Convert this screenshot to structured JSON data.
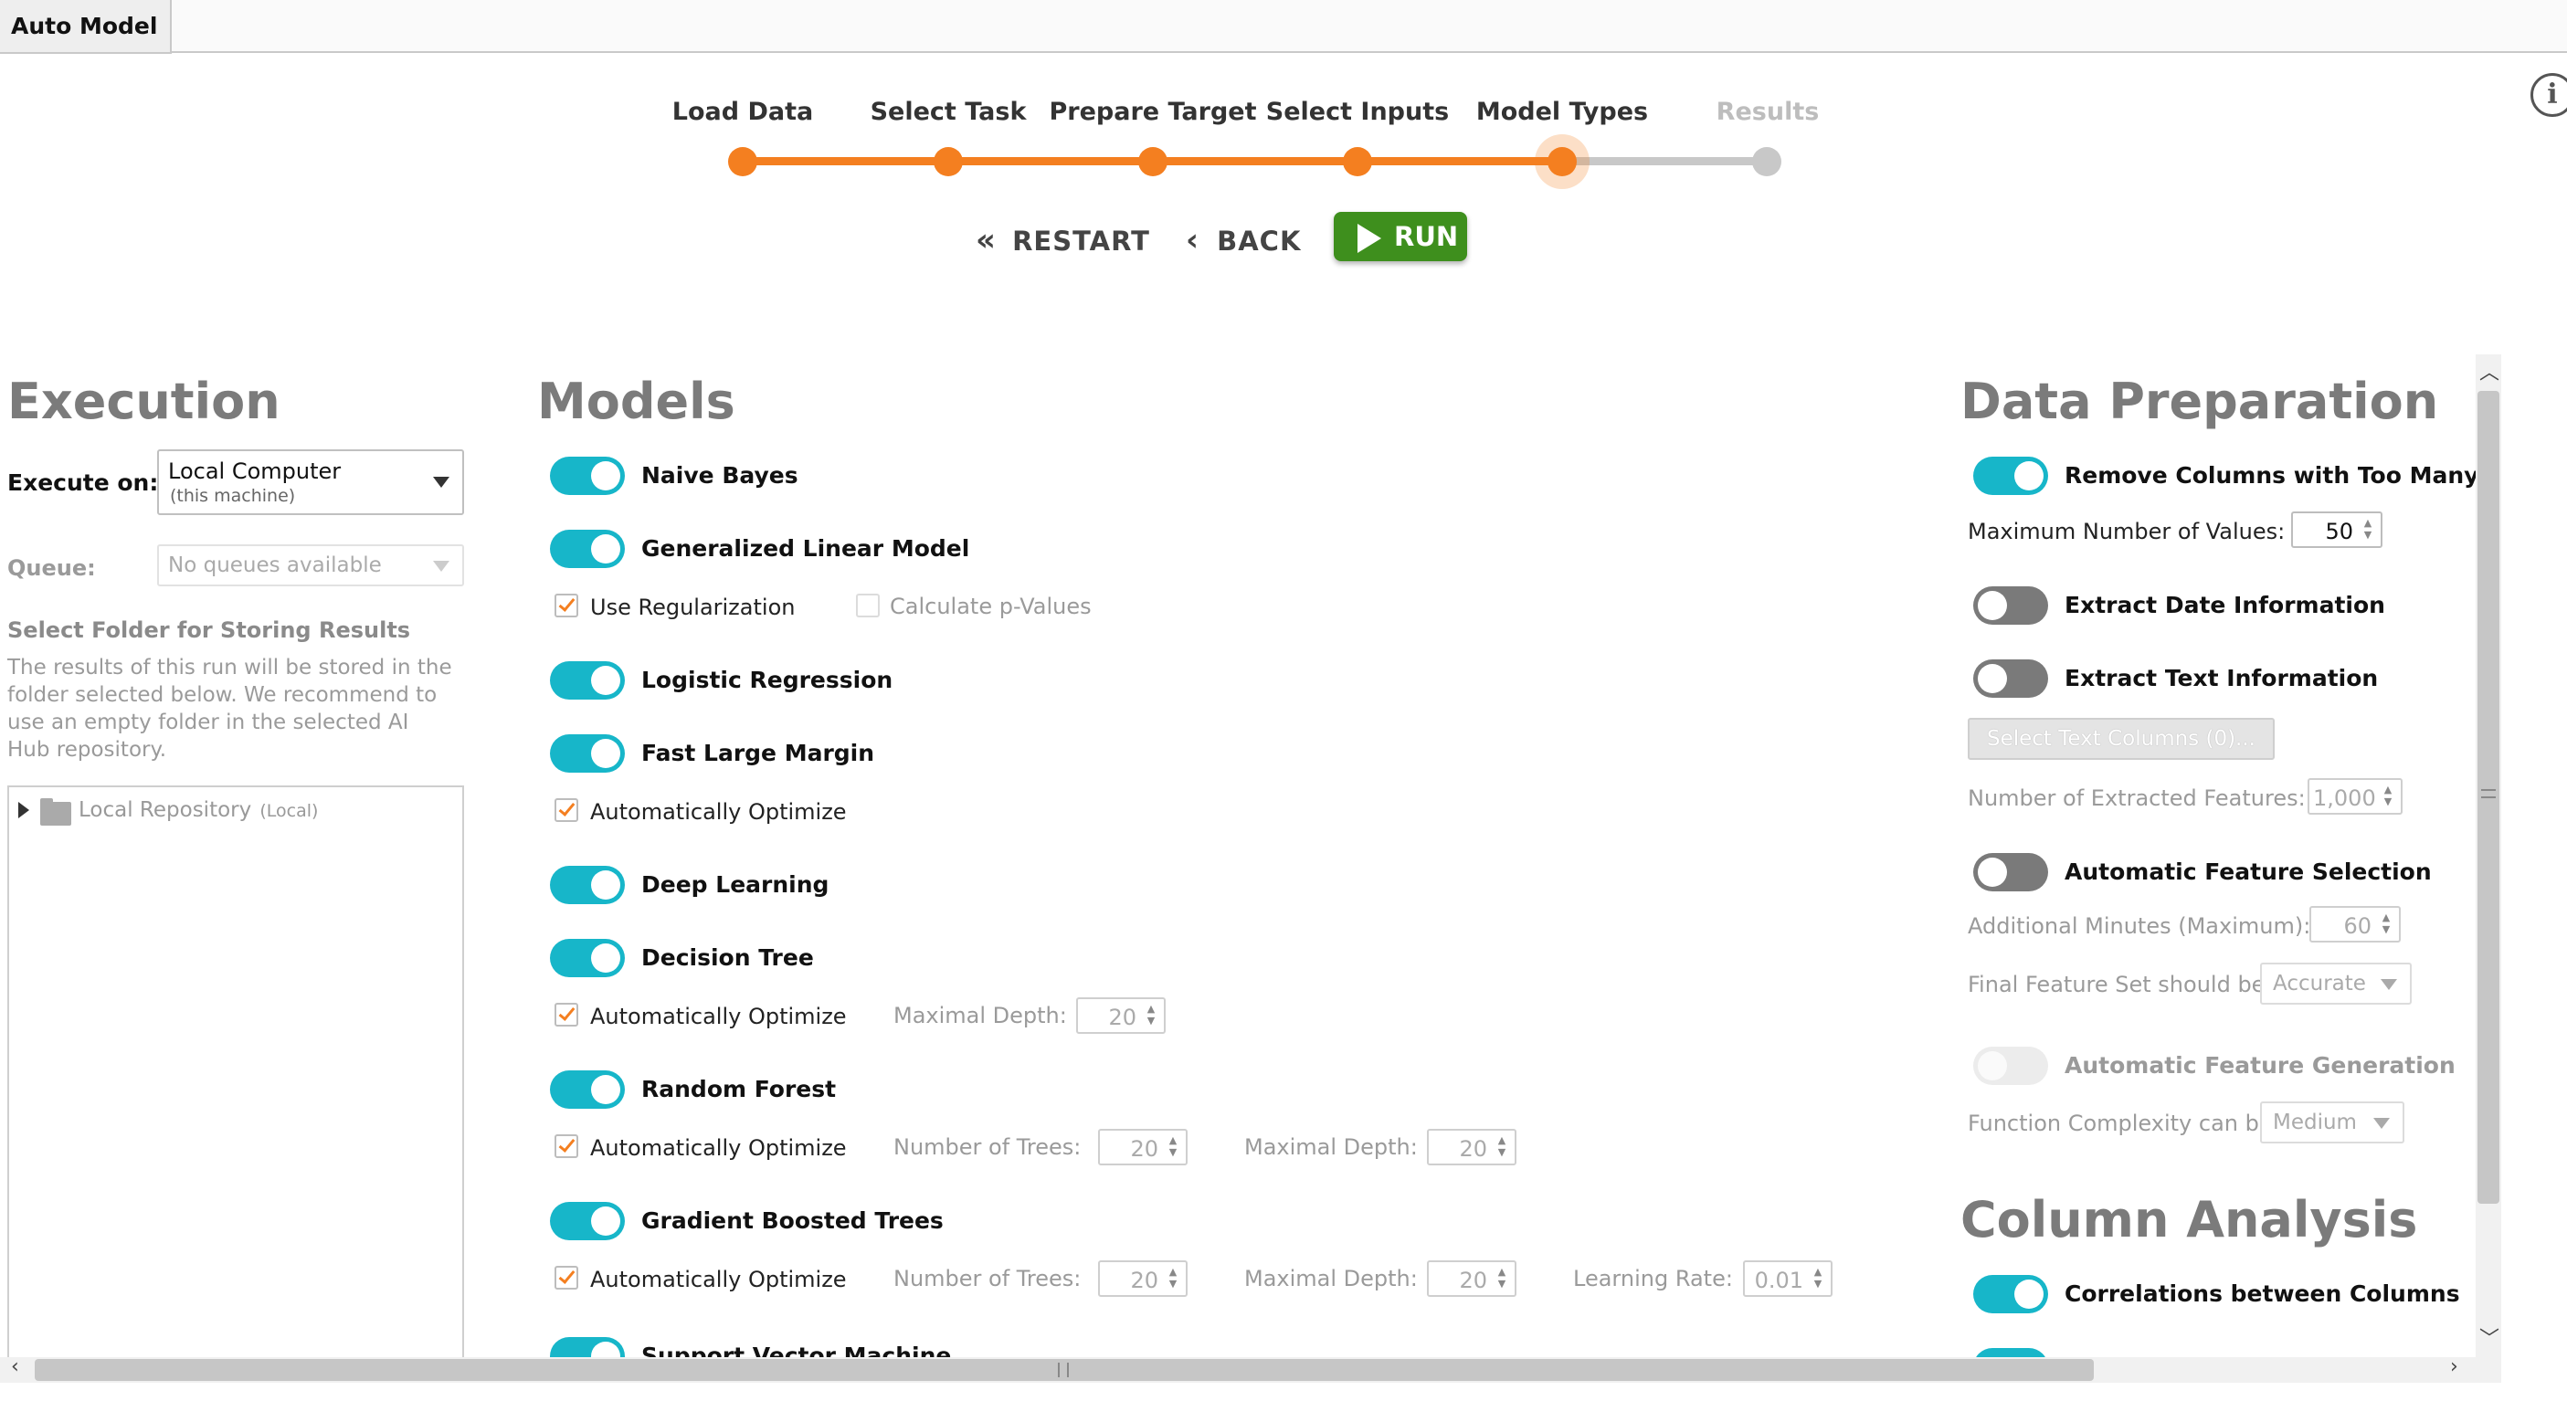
{
  "tab": {
    "label": "Auto Model"
  },
  "stepper": {
    "steps": [
      {
        "label": "Load Data",
        "state": "done"
      },
      {
        "label": "Select Task",
        "state": "done"
      },
      {
        "label": "Prepare Target",
        "state": "done"
      },
      {
        "label": "Select Inputs",
        "state": "done"
      },
      {
        "label": "Model Types",
        "state": "current"
      },
      {
        "label": "Results",
        "state": "pending"
      }
    ],
    "restart_label": "RESTART",
    "back_label": "BACK",
    "run_label": "RUN"
  },
  "colors": {
    "accent": "#f47f20",
    "toggle_on": "#17b6c9",
    "run": "#3e8f1d"
  },
  "execution": {
    "title": "Execution",
    "execute_on_label": "Execute on:",
    "execute_on_value": "Local Computer",
    "execute_on_sub": "(this machine)",
    "queue_label": "Queue:",
    "queue_value": "No queues available",
    "folder_title": "Select Folder for Storing Results",
    "folder_desc": "The results of this run will be stored in the folder selected below. We recommend to use an empty folder in the selected AI Hub repository.",
    "folder_desc_lines": [
      "The results of this run will be stored in the",
      "folder selected below. We recommend to",
      "use an empty folder in the selected AI",
      "Hub repository."
    ],
    "repo_label": "Local Repository",
    "repo_tag": "(Local)"
  },
  "models": {
    "title": "Models",
    "naive_bayes": {
      "label": "Naive Bayes",
      "on": true
    },
    "glm": {
      "label": "Generalized Linear Model",
      "on": true,
      "use_regularization": "Use Regularization",
      "calc_p_values": "Calculate p-Values"
    },
    "logistic_regression": {
      "label": "Logistic Regression",
      "on": true
    },
    "fast_large_margin": {
      "label": "Fast Large Margin",
      "on": true,
      "auto_optimize": "Automatically Optimize"
    },
    "deep_learning": {
      "label": "Deep Learning",
      "on": true
    },
    "decision_tree": {
      "label": "Decision Tree",
      "on": true,
      "auto_optimize": "Automatically Optimize",
      "max_depth_label": "Maximal Depth:",
      "max_depth": "20"
    },
    "random_forest": {
      "label": "Random Forest",
      "on": true,
      "auto_optimize": "Automatically Optimize",
      "num_trees_label": "Number of Trees:",
      "num_trees": "20",
      "max_depth_label": "Maximal Depth:",
      "max_depth": "20"
    },
    "gbt": {
      "label": "Gradient Boosted Trees",
      "on": true,
      "auto_optimize": "Automatically Optimize",
      "num_trees_label": "Number of Trees:",
      "num_trees": "20",
      "max_depth_label": "Maximal Depth:",
      "max_depth": "20",
      "learning_rate_label": "Learning Rate:",
      "learning_rate": "0.01"
    },
    "svm": {
      "label": "Support Vector Machine",
      "on": true
    }
  },
  "data_prep": {
    "title": "Data Preparation",
    "remove_columns": {
      "label": "Remove Columns with Too Many Va",
      "on": true
    },
    "max_values_label": "Maximum Number of Values:",
    "max_values": "50",
    "extract_date": {
      "label": "Extract Date Information",
      "on": false
    },
    "extract_text": {
      "label": "Extract Text Information",
      "on": false
    },
    "select_text_columns": "Select Text Columns (0)...",
    "num_features_label": "Number of Extracted Features:",
    "num_features": "1,000",
    "auto_feature_selection": {
      "label": "Automatic Feature Selection",
      "on": false
    },
    "additional_minutes_label": "Additional Minutes (Maximum):",
    "additional_minutes": "60",
    "final_feature_set_label": "Final Feature Set should be",
    "final_feature_set": "Accurate",
    "auto_feature_generation": {
      "label": "Automatic Feature Generation",
      "on": false
    },
    "function_complexity_label": "Function Complexity can be",
    "function_complexity": "Medium"
  },
  "column_analysis": {
    "title": "Column Analysis",
    "correlations": {
      "label": "Correlations between Columns",
      "on": true
    }
  }
}
